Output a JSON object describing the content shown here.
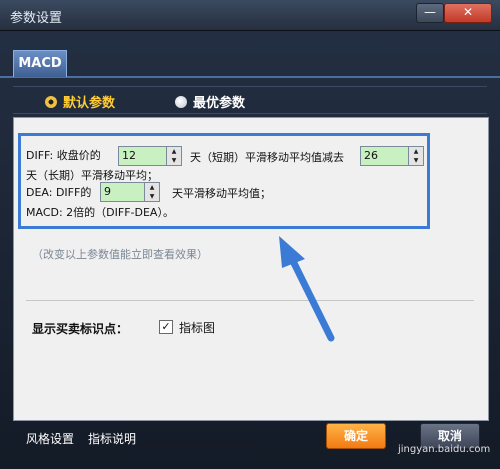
{
  "window": {
    "title": "参数设置",
    "minimize_glyph": "—",
    "close_glyph": "✕"
  },
  "tab": {
    "label": "MACD"
  },
  "radios": [
    {
      "label": "默认参数",
      "selected": true
    },
    {
      "label": "最优参数",
      "selected": false
    }
  ],
  "params": {
    "diff_prefix": "DIFF: 收盘价的",
    "short_value": "12",
    "diff_middle": "天（短期）平滑移动平均值减去",
    "long_value": "26",
    "diff_suffix": "天（长期）平滑移动平均；",
    "dea_prefix": "DEA: DIFF的",
    "dea_value": "9",
    "dea_suffix": "天平滑移动平均值；",
    "macd_text": "MACD: 2倍的（DIFF-DEA）。"
  },
  "hint": "（改变以上参数值能立即查看效果）",
  "signal": {
    "label": "显示买卖标识点：",
    "checkbox_label": "指标图",
    "checked": true,
    "check_glyph": "✓"
  },
  "footer": {
    "style_link": "风格设置",
    "help_link": "指标说明",
    "ok_label": "确定",
    "cancel_label": "取消"
  },
  "watermark": "jingyan.baidu.com",
  "colors": {
    "highlight": "#3b7bd6",
    "accent": "#f27a12",
    "selected_radio": "#ffcc33",
    "spin_bg": "#c9f0c0"
  }
}
